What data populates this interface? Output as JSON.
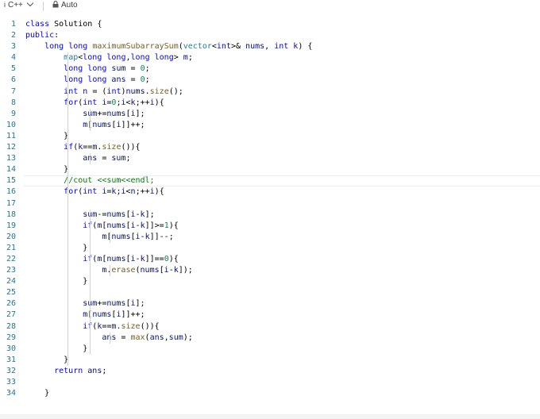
{
  "toolbar": {
    "language": "C++",
    "mode": "Auto",
    "icons": [
      "info-icon",
      "chevron-down-icon",
      "lock-icon"
    ]
  },
  "colors": {
    "keyword": "#0000ff",
    "type": "#267f99",
    "function": "#795e26",
    "number": "#098658",
    "comment": "#008000",
    "line_number": "#237893"
  },
  "editor": {
    "active_line": 15,
    "lines": [
      {
        "n": "1",
        "text": "class Solution {"
      },
      {
        "n": "2",
        "text": "public:"
      },
      {
        "n": "3",
        "text": "    long long maximumSubarraySum(vector<int>& nums, int k) {"
      },
      {
        "n": "4",
        "text": "        map<long long,long long> m;"
      },
      {
        "n": "5",
        "text": "        long long sum = 0;"
      },
      {
        "n": "6",
        "text": "        long long ans = 0;"
      },
      {
        "n": "7",
        "text": "        int n = (int)nums.size();"
      },
      {
        "n": "8",
        "text": "        for(int i=0;i<k;++i){"
      },
      {
        "n": "9",
        "text": "            sum+=nums[i];"
      },
      {
        "n": "10",
        "text": "            m[nums[i]]++;"
      },
      {
        "n": "11",
        "text": "        }"
      },
      {
        "n": "12",
        "text": "        if(k==m.size()){"
      },
      {
        "n": "13",
        "text": "            ans = sum;"
      },
      {
        "n": "14",
        "text": "        }"
      },
      {
        "n": "15",
        "text": "        //cout <<sum<<endl;"
      },
      {
        "n": "16",
        "text": "        for(int i=k;i<n;++i){"
      },
      {
        "n": "17",
        "text": ""
      },
      {
        "n": "18",
        "text": "            sum-=nums[i-k];"
      },
      {
        "n": "19",
        "text": "            if(m[nums[i-k]]>=1){"
      },
      {
        "n": "20",
        "text": "                m[nums[i-k]]--;"
      },
      {
        "n": "21",
        "text": "            }"
      },
      {
        "n": "22",
        "text": "            if(m[nums[i-k]]==0){"
      },
      {
        "n": "23",
        "text": "                m.erase(nums[i-k]);"
      },
      {
        "n": "24",
        "text": "            }"
      },
      {
        "n": "25",
        "text": ""
      },
      {
        "n": "26",
        "text": "            sum+=nums[i];"
      },
      {
        "n": "27",
        "text": "            m[nums[i]]++;"
      },
      {
        "n": "28",
        "text": "            if(k==m.size()){"
      },
      {
        "n": "29",
        "text": "                ans = max(ans,sum);"
      },
      {
        "n": "30",
        "text": "            }"
      },
      {
        "n": "31",
        "text": "        }"
      },
      {
        "n": "32",
        "text": "      return ans;"
      },
      {
        "n": "33",
        "text": ""
      },
      {
        "n": "34",
        "text": "    }"
      }
    ]
  }
}
